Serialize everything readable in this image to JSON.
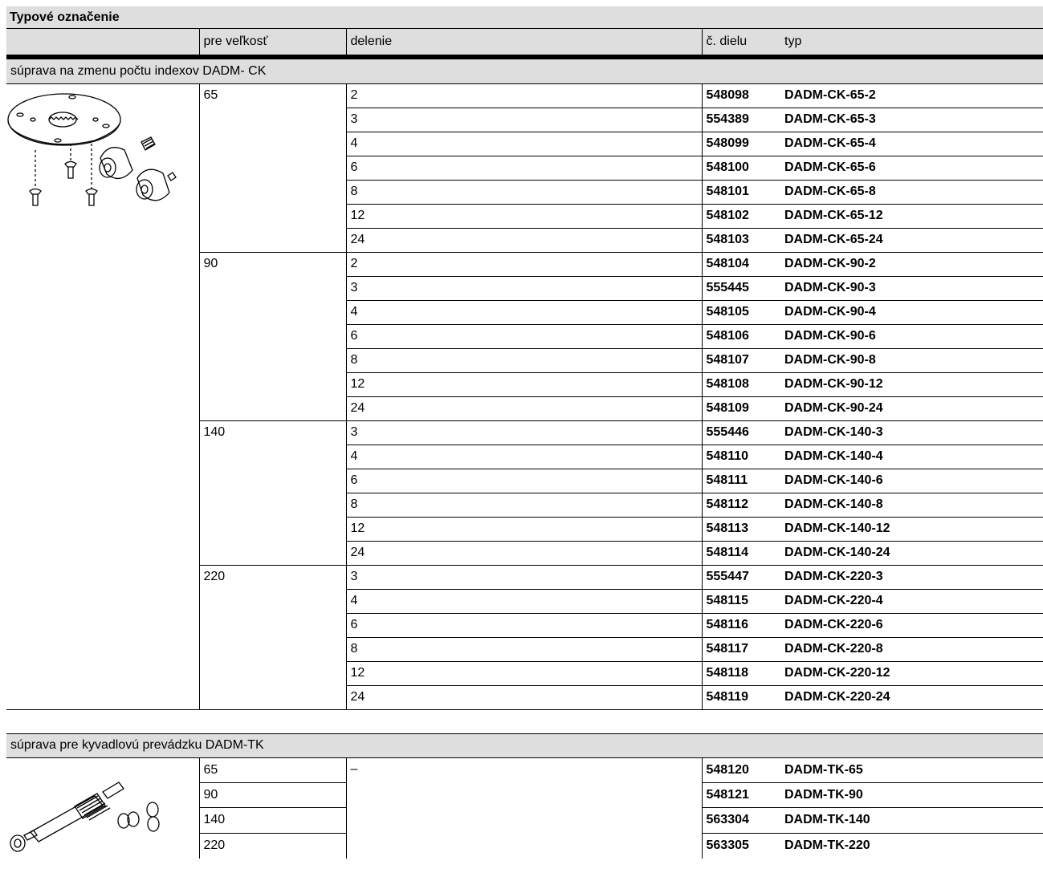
{
  "title": "Typové označenie",
  "headers": {
    "size": "pre veľkosť",
    "division": "delenie",
    "part_no": "č. dielu",
    "type": "typ"
  },
  "section_ck": {
    "label": "súprava na zmenu počtu indexov DADM- CK",
    "groups": [
      {
        "size": "65",
        "rows": [
          {
            "div": "2",
            "pn": "548098",
            "type": "DADM-CK-65-2"
          },
          {
            "div": "3",
            "pn": "554389",
            "type": "DADM-CK-65-3"
          },
          {
            "div": "4",
            "pn": "548099",
            "type": "DADM-CK-65-4"
          },
          {
            "div": "6",
            "pn": "548100",
            "type": "DADM-CK-65-6"
          },
          {
            "div": "8",
            "pn": "548101",
            "type": "DADM-CK-65-8"
          },
          {
            "div": "12",
            "pn": "548102",
            "type": "DADM-CK-65-12"
          },
          {
            "div": "24",
            "pn": "548103",
            "type": "DADM-CK-65-24"
          }
        ]
      },
      {
        "size": "90",
        "rows": [
          {
            "div": "2",
            "pn": "548104",
            "type": "DADM-CK-90-2"
          },
          {
            "div": "3",
            "pn": "555445",
            "type": "DADM-CK-90-3"
          },
          {
            "div": "4",
            "pn": "548105",
            "type": "DADM-CK-90-4"
          },
          {
            "div": "6",
            "pn": "548106",
            "type": "DADM-CK-90-6"
          },
          {
            "div": "8",
            "pn": "548107",
            "type": "DADM-CK-90-8"
          },
          {
            "div": "12",
            "pn": "548108",
            "type": "DADM-CK-90-12"
          },
          {
            "div": "24",
            "pn": "548109",
            "type": "DADM-CK-90-24"
          }
        ]
      },
      {
        "size": "140",
        "rows": [
          {
            "div": "3",
            "pn": "555446",
            "type": "DADM-CK-140-3"
          },
          {
            "div": "4",
            "pn": "548110",
            "type": "DADM-CK-140-4"
          },
          {
            "div": "6",
            "pn": "548111",
            "type": "DADM-CK-140-6"
          },
          {
            "div": "8",
            "pn": "548112",
            "type": "DADM-CK-140-8"
          },
          {
            "div": "12",
            "pn": "548113",
            "type": "DADM-CK-140-12"
          },
          {
            "div": "24",
            "pn": "548114",
            "type": "DADM-CK-140-24"
          }
        ]
      },
      {
        "size": "220",
        "rows": [
          {
            "div": "3",
            "pn": "555447",
            "type": "DADM-CK-220-3"
          },
          {
            "div": "4",
            "pn": "548115",
            "type": "DADM-CK-220-4"
          },
          {
            "div": "6",
            "pn": "548116",
            "type": "DADM-CK-220-6"
          },
          {
            "div": "8",
            "pn": "548117",
            "type": "DADM-CK-220-8"
          },
          {
            "div": "12",
            "pn": "548118",
            "type": "DADM-CK-220-12"
          },
          {
            "div": "24",
            "pn": "548119",
            "type": "DADM-CK-220-24"
          }
        ]
      }
    ]
  },
  "section_tk": {
    "label": "súprava pre kyvadlovú prevádzku DADM-TK",
    "division": "–",
    "rows": [
      {
        "size": "65",
        "pn": "548120",
        "type": "DADM-TK-65"
      },
      {
        "size": "90",
        "pn": "548121",
        "type": "DADM-TK-90"
      },
      {
        "size": "140",
        "pn": "563304",
        "type": "DADM-TK-140"
      },
      {
        "size": "220",
        "pn": "563305",
        "type": "DADM-TK-220"
      }
    ]
  },
  "icons": {
    "ck_kit": "index-plate-kit-drawing",
    "tk_kit": "pendulum-kit-drawing"
  }
}
